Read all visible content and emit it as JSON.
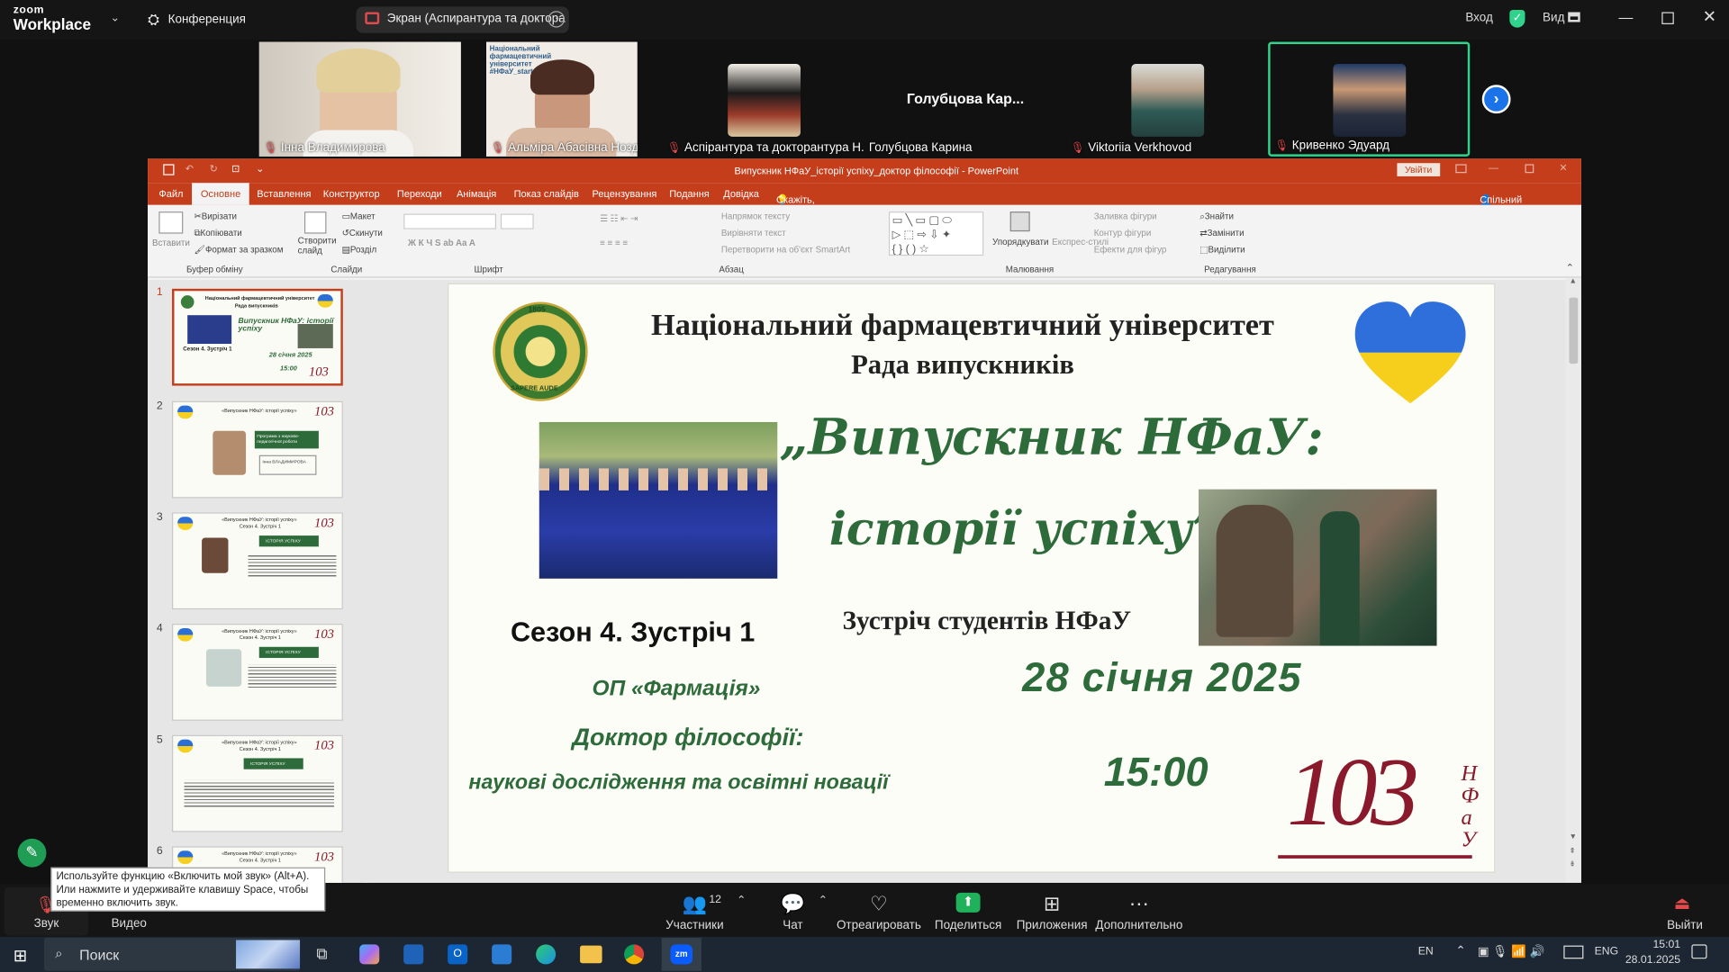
{
  "zoom": {
    "logo_zoom": "zoom",
    "logo_workplace": "Workplace",
    "conference_label": "Конференция",
    "share_pill": "Экран (Аспирантура та доктора",
    "login": "Вход",
    "view": "Вид"
  },
  "participants": [
    {
      "name": "Інна Владимирова"
    },
    {
      "name": "Альміра Абасівна Ноздріна"
    },
    {
      "name": "Аспірантура та докторантура Н..."
    },
    {
      "name": "Голубцова Карина",
      "big_name": "Голубцова Кар..."
    },
    {
      "name": "Viktoriia Verkhovod"
    },
    {
      "name": "Кривенко Эдуард"
    }
  ],
  "ppt": {
    "title": "Випускник НФаУ_історії успіху_доктор філософії - PowerPoint",
    "signin": "Увійти",
    "share": "Спільний доступ",
    "tabs": [
      "Файл",
      "Основне",
      "Вставлення",
      "Конструктор",
      "Переходи",
      "Анімація",
      "Показ слайдів",
      "Рецензування",
      "Подання",
      "Довідка"
    ],
    "tell_me": "Скажіть, що потрібно зробити",
    "ribbon": {
      "paste": "Вставити",
      "cut": "Вирізати",
      "copy": "Копіювати",
      "format_painter": "Формат за зразком",
      "clipboard": "Буфер обміну",
      "new_slide": "Створити слайд",
      "layout": "Макет",
      "reset": "Скинути",
      "section": "Розділ",
      "slides": "Слайди",
      "font": "Шрифт",
      "text_direction": "Напрямок тексту",
      "align_text": "Вирівняти текст",
      "smartart": "Перетворити на об'єкт SmartArt",
      "paragraph": "Абзац",
      "arrange": "Упорядкувати",
      "quick_styles": "Експрес-стилі",
      "shape_fill": "Заливка фігури",
      "shape_outline": "Контур фігури",
      "shape_effects": "Ефекти для фігур",
      "drawing": "Малювання",
      "find": "Знайти",
      "replace": "Замінити",
      "select": "Виділити",
      "editing": "Редагування"
    },
    "slide_numbers": [
      "1",
      "2",
      "3",
      "4",
      "5",
      "6"
    ],
    "thumbs": {
      "t1_title": "Національний фармацевтичний університет",
      "t1_sub": "Рада випускників",
      "t1_script": "Випускник НФаУ: історії успіху",
      "t1_season": "Сезон 4. Зустріч 1",
      "t1_date": "28 січня 2025",
      "t1_time": "15:00",
      "t_head": "«Випускник НФаУ: історії успіху»",
      "t_season": "Сезон 4. Зустріч 1",
      "t_badge": "ІСТОРІЯ УСПІХУ",
      "t2_badge": "Програма з науково-педагогічної роботи",
      "t2_name": "Інна ВЛАДИМИРОВА"
    }
  },
  "slide": {
    "university": "Національний фармацевтичний університет",
    "council": "Рада випускників",
    "script_line1": "„Випускник НФаУ:",
    "script_line2": "історії успіху”",
    "season": "Сезон 4. Зустріч 1",
    "meeting": "Зустріч студентів НФаУ",
    "date": "28 січня 2025",
    "op": "ОП «Фармація»",
    "doctor": "Доктор філософії:",
    "research": "наукові дослідження та освітні новації",
    "time": "15:00",
    "anniv": "103",
    "nfau": "НФаУ",
    "logo_year": "1805",
    "logo_motto": "SAPERE AUDE"
  },
  "tooltip": "Используйте функцию «Включить мой звук» (Alt+A). Или нажмите и удерживайте клавишу Space, чтобы временно включить звук.",
  "bottom": {
    "audio": "Звук",
    "video": "Видео",
    "participants": "Участники",
    "participants_count": "12",
    "chat": "Чат",
    "react": "Отреагировать",
    "share": "Поделиться",
    "apps": "Приложения",
    "more": "Дополнительно",
    "leave": "Выйти"
  },
  "taskbar": {
    "search": "Поиск",
    "lang1": "EN",
    "lang2": "ENG",
    "time": "15:01",
    "date": "28.01.2025"
  },
  "colors": {
    "ppt_accent": "#c43e1c",
    "slide_green": "#2e6b3a",
    "slide_red": "#8a1a2b",
    "zoom_green": "#2fd38b"
  }
}
